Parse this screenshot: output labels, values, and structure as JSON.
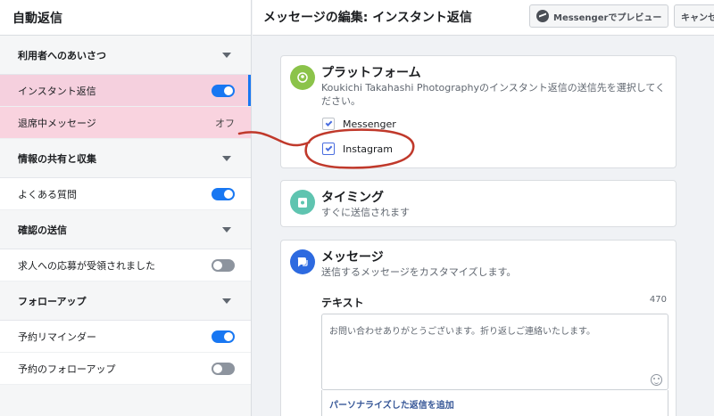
{
  "sidebar": {
    "title": "自動返信",
    "sections": [
      {
        "label": "利用者へのあいさつ"
      },
      {
        "label": "情報の共有と収集"
      },
      {
        "label": "確認の送信"
      },
      {
        "label": "フォローアップ"
      }
    ],
    "items": [
      {
        "label": "インスタント返信",
        "toggle": "on"
      },
      {
        "label": "退席中メッセージ",
        "status": "オフ"
      },
      {
        "label": "よくある質問",
        "toggle": "on"
      },
      {
        "label": "求人への応募が受領されました",
        "toggle": "off"
      },
      {
        "label": "予約リマインダー",
        "toggle": "on"
      },
      {
        "label": "予約のフォローアップ",
        "toggle": "off"
      }
    ]
  },
  "header": {
    "title": "メッセージの編集: インスタント返信",
    "preview_label": "Messengerでプレビュー",
    "cancel_label": "キャンセル"
  },
  "platform_card": {
    "icon": "platform-icon",
    "title": "プラットフォーム",
    "description": "Koukichi Takahashi Photographyのインスタント返信の送信先を選択してください。",
    "options": [
      {
        "label": "Messenger",
        "checked": true
      },
      {
        "label": "Instagram",
        "checked": true
      }
    ]
  },
  "timing_card": {
    "icon": "timing-icon",
    "title": "タイミング",
    "description": "すぐに送信されます"
  },
  "message_card": {
    "icon": "message-icon",
    "title": "メッセージ",
    "description": "送信するメッセージをカスタマイズします。",
    "text_label": "テキスト",
    "char_count": "470",
    "message_text": "お問い合わせありがとうございます。折り返しご連絡いたします。",
    "personalize_label": "パーソナライズした返信を追加"
  },
  "colors": {
    "accent": "#1877f2",
    "highlight": "#f5d0de",
    "annotation": "#c0392b"
  }
}
